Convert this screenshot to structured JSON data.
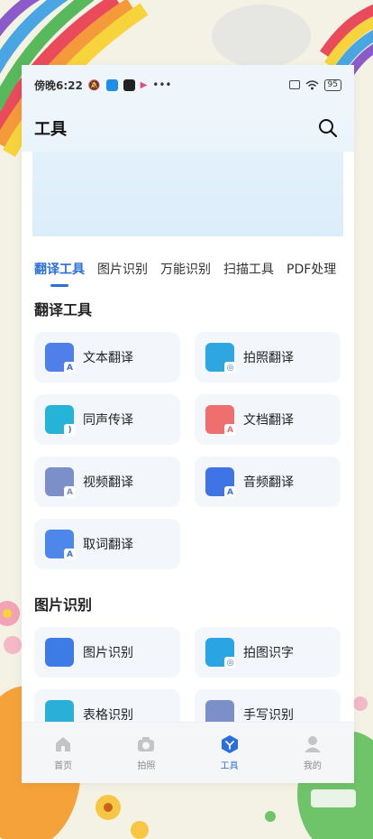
{
  "status_bar": {
    "time": "傍晚6:22",
    "dots": "•••",
    "battery": "95"
  },
  "header": {
    "title": "工具"
  },
  "tabs": [
    {
      "label": "翻译工具",
      "active": true
    },
    {
      "label": "图片识别",
      "active": false
    },
    {
      "label": "万能识别",
      "active": false
    },
    {
      "label": "扫描工具",
      "active": false
    },
    {
      "label": "PDF处理",
      "active": false
    }
  ],
  "sections": [
    {
      "title": "翻译工具",
      "items": [
        {
          "label": "文本翻译",
          "icon": "text-translate-icon",
          "color": "#4f7fe8"
        },
        {
          "label": "拍照翻译",
          "icon": "photo-translate-icon",
          "color": "#2ea7e0"
        },
        {
          "label": "同声传译",
          "icon": "simultaneous-icon",
          "color": "#25b4d8"
        },
        {
          "label": "文档翻译",
          "icon": "document-translate-icon",
          "color": "#ef6e6e"
        },
        {
          "label": "视频翻译",
          "icon": "video-translate-icon",
          "color": "#7b8fc8"
        },
        {
          "label": "音频翻译",
          "icon": "audio-translate-icon",
          "color": "#3f74e5"
        },
        {
          "label": "取词翻译",
          "icon": "word-pick-icon",
          "color": "#4d87ea"
        }
      ]
    },
    {
      "title": "图片识别",
      "items": [
        {
          "label": "图片识别",
          "icon": "image-recognize-icon",
          "color": "#3d7be6"
        },
        {
          "label": "拍图识字",
          "icon": "photo-ocr-icon",
          "color": "#2aa5e3"
        },
        {
          "label": "表格识别",
          "icon": "table-recognize-icon",
          "color": "#2ab0d8"
        },
        {
          "label": "手写识别",
          "icon": "handwriting-icon",
          "color": "#7b8fc8"
        }
      ]
    }
  ],
  "tabbar": [
    {
      "label": "首页",
      "icon": "home-icon",
      "active": false
    },
    {
      "label": "拍照",
      "icon": "camera-icon",
      "active": false
    },
    {
      "label": "工具",
      "icon": "tools-icon",
      "active": true
    },
    {
      "label": "我的",
      "icon": "profile-icon",
      "active": false
    }
  ],
  "colors": {
    "accent": "#2a6fdb",
    "card_bg": "#f3f7fb"
  }
}
